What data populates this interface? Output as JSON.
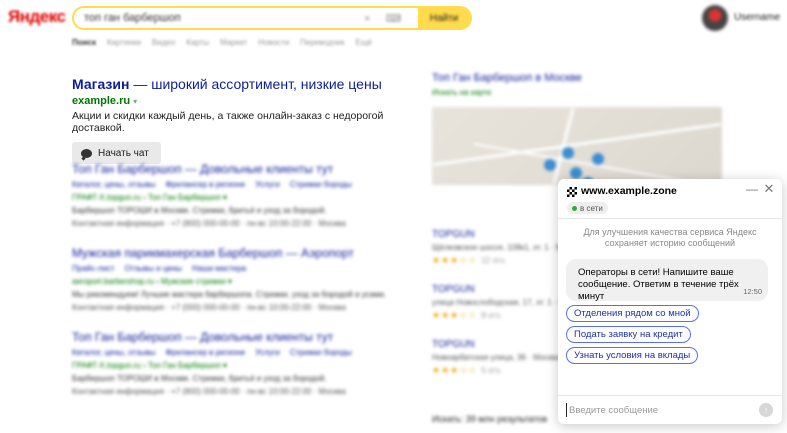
{
  "header": {
    "logo": "Яндекс",
    "search_value": "топ ган барбершоп",
    "search_tools": "× ⌨ ↑",
    "search_button": "Найти",
    "username": "Username"
  },
  "tabs": [
    "Поиск",
    "Картинки",
    "Видео",
    "Карты",
    "Маркет",
    "Новости",
    "Переводчик",
    "Ещё"
  ],
  "ad": {
    "title_bold": "Магазин",
    "title_rest": " — широкий ассортимент, низкие цены",
    "url": "example.ru",
    "url_caret": "▾",
    "description": "Акции и скидки каждый день, а также онлайн-заказ с недорогой доставкой.",
    "chat_button": "Начать чат"
  },
  "results": [
    {
      "title": "Топ Ган Барбершоп — Довольные клиенты тут",
      "links": [
        "Каталог, цены, отзывы",
        "Фрилансер в регионе",
        "Услуги",
        "Стрижки бороды"
      ],
      "url": "ГРАФТ-Х.topgun.ru › Топ Ган Барбершоп ▾",
      "text": "Барбершоп ТОРОШИ в Москве. Стрижки, бритьё и уход за бородой.",
      "foot": "Контактная информация · +7 (800) 000-00-00 · пн-вс 10:00-22:00 · Москва"
    },
    {
      "title": "Мужская парикмахерская Барбершоп — Аэропорт",
      "links": [
        "Прайс-лист",
        "Отзывы и цены",
        "Наши мастера"
      ],
      "url": "aeroport.barbershop.ru › Мужские стрижки ▾",
      "text": "Мы рекомендуем! Лучшие мастера барбершопа. Стрижки, уход за бородой и усами.",
      "foot": "Контактная информация · +7 (000) 000-00-00 · пн-вс 10:00-22:00 · Москва"
    },
    {
      "title": "Топ Ган Барбершоп — Довольные клиенты тут",
      "links": [
        "Каталог, цены, отзывы",
        "Фрилансер в регионе",
        "Услуги",
        "Стрижки бороды"
      ],
      "url": "ГРАФТ-Х.topgun.ru › Топ Ган Барбершоп ▾",
      "text": "Барбершоп ТОРОШИ в Москве. Стрижки, бритьё и уход за бородой.",
      "foot": "Контактная информация · +7 (800) 000-00-00 · пн-вс 10:00-22:00 · Москва"
    }
  ],
  "right": {
    "title": "Топ Ган Барбершоп в Москве",
    "subtitle": "Искать на карте",
    "orgs": [
      {
        "title": "TOPGUN",
        "addr": "Щёлковское шоссе, 108к1, эт. 1 · Москва",
        "stars": "★★★☆☆",
        "count": "12 отз."
      },
      {
        "title": "TOPGUN",
        "addr": "улица Новослободская, 17, эт. 1 · Москва",
        "stars": "★★★☆☆",
        "count": "8 отз."
      },
      {
        "title": "TOPGUN",
        "addr": "Новоарбатская улица, 36 · Москва",
        "stars": "★★★☆☆",
        "count": "5 отз."
      }
    ],
    "bottom_note": "Искать: 39 млн результатов"
  },
  "chat": {
    "site_name": "www.example.zone",
    "status": "в сети",
    "minimize": "—",
    "close": "✕",
    "notice": "Для улучшения качества сервиса Яндекс сохраняет историю сообщений",
    "message": "Операторы в сети! Напишите ваше сообщение. Ответим в течение трёх минут",
    "message_time": "12:50",
    "quick_replies": [
      "Отделения рядом со мной",
      "Подать заявку на кредит",
      "Узнать условия на вклады"
    ],
    "input_placeholder": "Введите сообщение",
    "send": "↑"
  },
  "colors": {
    "search_accent": "#ffdb4d",
    "link": "#0e1e99",
    "url_green": "#007700",
    "quick_border": "#5b6ef2",
    "online": "#3aa635"
  }
}
